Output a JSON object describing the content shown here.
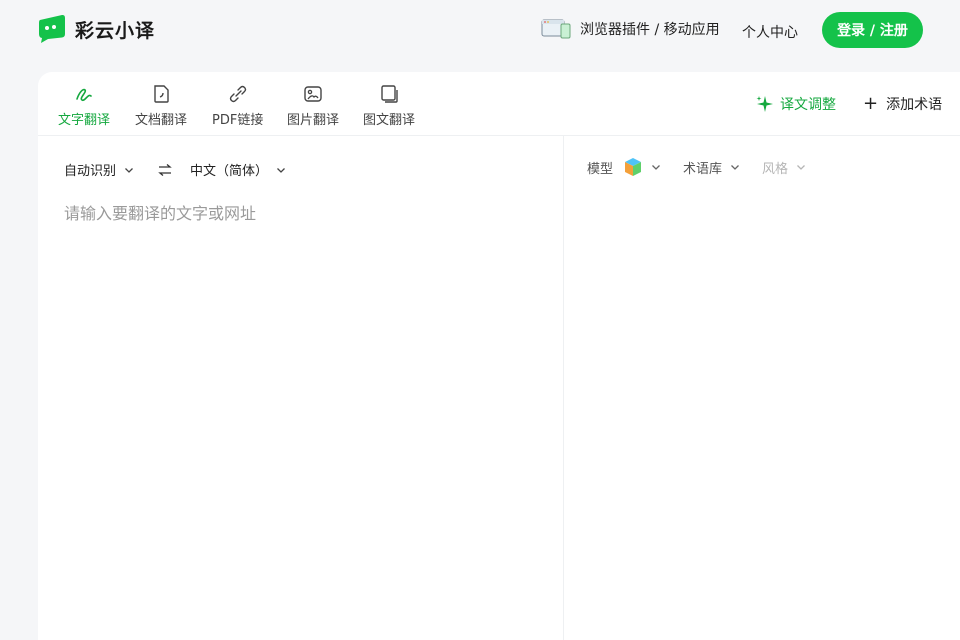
{
  "header": {
    "app_name": "彩云小译",
    "plugin_link": "浏览器插件 / 移动应用",
    "user_center": "个人中心",
    "login_button": "登录 / 注册"
  },
  "tabs": [
    {
      "label": "文字翻译",
      "active": true
    },
    {
      "label": "文档翻译",
      "active": false
    },
    {
      "label": "PDF链接",
      "active": false
    },
    {
      "label": "图片翻译",
      "active": false
    },
    {
      "label": "图文翻译",
      "active": false
    }
  ],
  "toolbar": {
    "adjust_label": "译文调整",
    "add_term_label": "添加术语"
  },
  "source": {
    "from_lang": "自动识别",
    "to_lang": "中文（简体）",
    "placeholder": "请输入要翻译的文字或网址"
  },
  "target": {
    "model_label": "模型",
    "glossary_label": "术语库",
    "style_label": "风格"
  },
  "colors": {
    "brand": "#14c24a",
    "brand_text": "#15a83f",
    "background": "#f5f6f8"
  }
}
